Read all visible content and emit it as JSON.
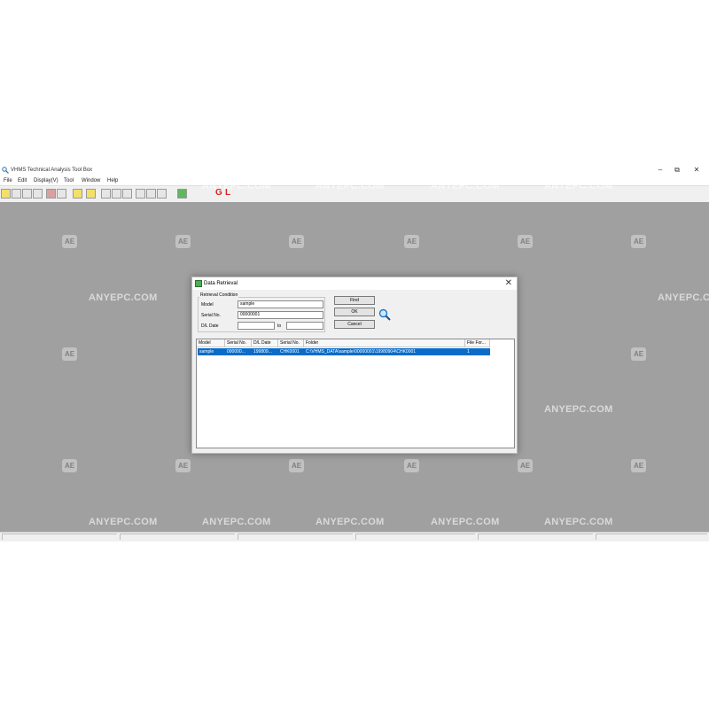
{
  "app": {
    "title": "VHMS Technical Analysis Tool Box",
    "window_controls": {
      "minimize": "–",
      "restore": "⧉",
      "close": "✕"
    },
    "menu": [
      "File",
      "Edit",
      "Display(V)",
      "Tool",
      "Window",
      "Help"
    ],
    "toolbar_gl": {
      "g": "G",
      "l": "L"
    }
  },
  "watermark": {
    "text": "ANYEPC.COM",
    "badge": "AE"
  },
  "dialog": {
    "title": "Data Retrieval",
    "close": "✕",
    "group_title": "Retrieval Condition",
    "model_label": "Model",
    "model_value": "sample",
    "serial_label": "Serial No.",
    "serial_value": "00000001",
    "date_label": "D/L Date",
    "date_from": "",
    "date_to": "",
    "to_label": "to",
    "buttons": {
      "find": "Find",
      "ok": "OK",
      "cancel": "Cancel"
    },
    "list": {
      "headers": [
        "Model",
        "Serial No.",
        "D/L Date",
        "Serial No.",
        "Folder",
        "File For..."
      ],
      "rows": [
        [
          "sample",
          "000000...",
          "199809...",
          "CHK0001",
          "C:\\VHMS_DATA\\sample\\00000001\\19980904\\CHK0001",
          "1"
        ]
      ]
    }
  }
}
